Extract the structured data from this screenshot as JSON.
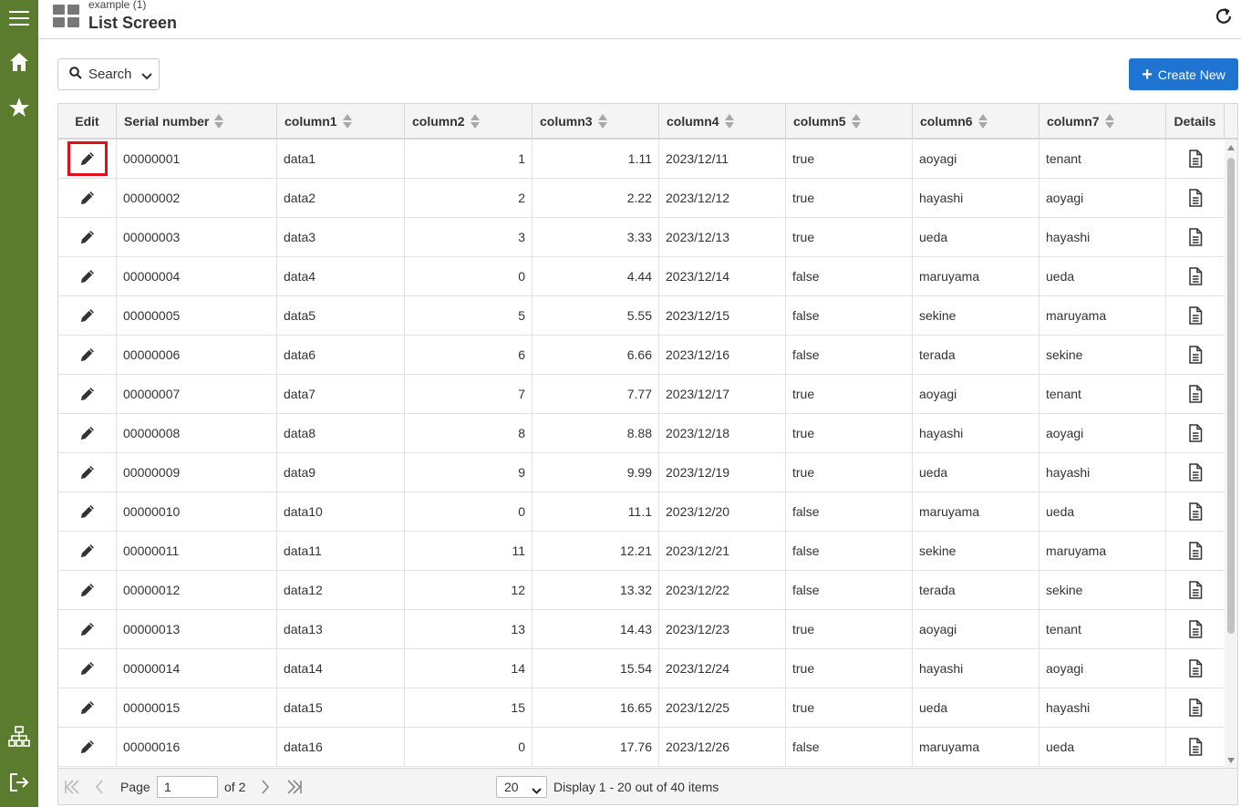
{
  "header": {
    "app_subtitle": "example (1)",
    "title": "List Screen"
  },
  "toolbar": {
    "search_label": "Search",
    "create_label": "Create New"
  },
  "colors": {
    "sidebar": "#5b7b2e",
    "primary": "#1f74d1",
    "highlight": "#e0101a"
  },
  "icons": {
    "sidebar": [
      "menu-icon",
      "home-icon",
      "star-icon",
      "sitemap-icon",
      "logout-icon"
    ],
    "header": [
      "grid-app-icon",
      "refresh-icon"
    ],
    "row": [
      "pencil-icon",
      "document-icon"
    ]
  },
  "table": {
    "columns": [
      "Edit",
      "Serial number",
      "column1",
      "column2",
      "column3",
      "column4",
      "column5",
      "column6",
      "column7",
      "Details"
    ],
    "rows": [
      [
        "00000001",
        "data1",
        "1",
        "1.11",
        "2023/12/11",
        "true",
        "aoyagi",
        "tenant"
      ],
      [
        "00000002",
        "data2",
        "2",
        "2.22",
        "2023/12/12",
        "true",
        "hayashi",
        "aoyagi"
      ],
      [
        "00000003",
        "data3",
        "3",
        "3.33",
        "2023/12/13",
        "true",
        "ueda",
        "hayashi"
      ],
      [
        "00000004",
        "data4",
        "0",
        "4.44",
        "2023/12/14",
        "false",
        "maruyama",
        "ueda"
      ],
      [
        "00000005",
        "data5",
        "5",
        "5.55",
        "2023/12/15",
        "false",
        "sekine",
        "maruyama"
      ],
      [
        "00000006",
        "data6",
        "6",
        "6.66",
        "2023/12/16",
        "false",
        "terada",
        "sekine"
      ],
      [
        "00000007",
        "data7",
        "7",
        "7.77",
        "2023/12/17",
        "true",
        "aoyagi",
        "tenant"
      ],
      [
        "00000008",
        "data8",
        "8",
        "8.88",
        "2023/12/18",
        "true",
        "hayashi",
        "aoyagi"
      ],
      [
        "00000009",
        "data9",
        "9",
        "9.99",
        "2023/12/19",
        "true",
        "ueda",
        "hayashi"
      ],
      [
        "00000010",
        "data10",
        "0",
        "11.1",
        "2023/12/20",
        "false",
        "maruyama",
        "ueda"
      ],
      [
        "00000011",
        "data11",
        "11",
        "12.21",
        "2023/12/21",
        "false",
        "sekine",
        "maruyama"
      ],
      [
        "00000012",
        "data12",
        "12",
        "13.32",
        "2023/12/22",
        "false",
        "terada",
        "sekine"
      ],
      [
        "00000013",
        "data13",
        "13",
        "14.43",
        "2023/12/23",
        "true",
        "aoyagi",
        "tenant"
      ],
      [
        "00000014",
        "data14",
        "14",
        "15.54",
        "2023/12/24",
        "true",
        "hayashi",
        "aoyagi"
      ],
      [
        "00000015",
        "data15",
        "15",
        "16.65",
        "2023/12/25",
        "true",
        "ueda",
        "hayashi"
      ],
      [
        "00000016",
        "data16",
        "0",
        "17.76",
        "2023/12/26",
        "false",
        "maruyama",
        "ueda"
      ]
    ]
  },
  "pager": {
    "page_label": "Page",
    "page_value": "1",
    "of_label": "of 2",
    "page_size": "20",
    "summary": "Display 1 - 20 out of 40 items"
  }
}
